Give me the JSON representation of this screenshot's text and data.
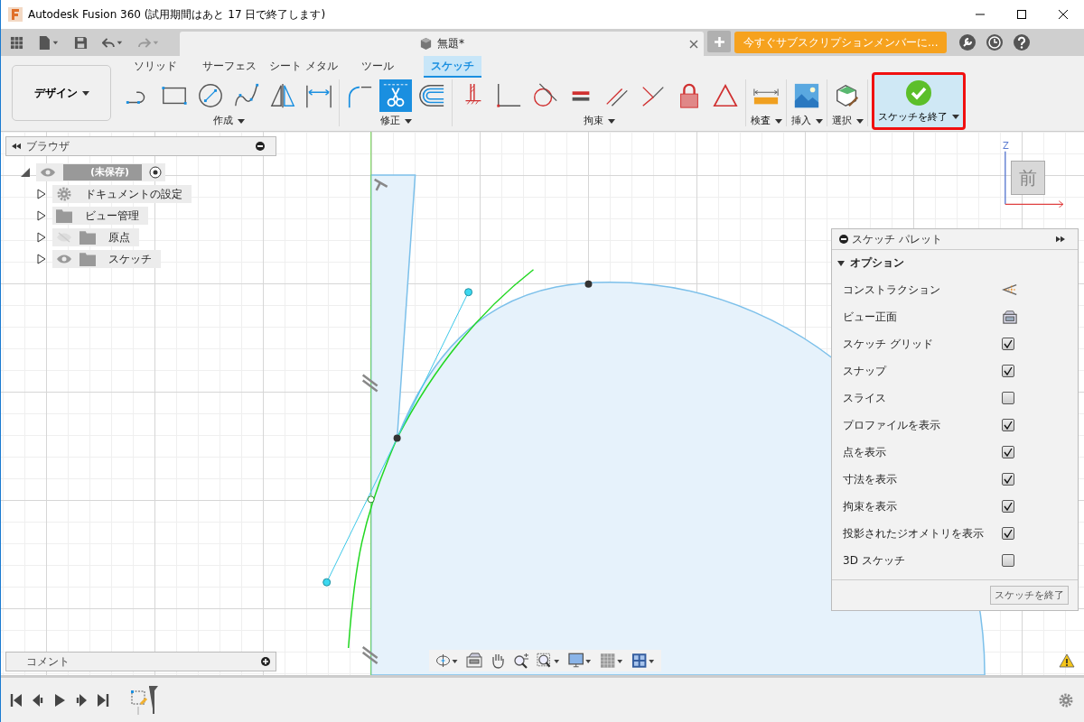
{
  "window": {
    "title": "Autodesk Fusion 360 (試用期間はあと 17 日で終了します)"
  },
  "document_tab": {
    "title": "無題*"
  },
  "subscribe_button": {
    "label": "今すぐサブスクリプションメンバーに..."
  },
  "workspace": {
    "label": "デザイン"
  },
  "ribbon_tabs": [
    {
      "label": "ソリッド",
      "selected": false
    },
    {
      "label": "サーフェス",
      "selected": false
    },
    {
      "label": "シート メタル",
      "selected": false
    },
    {
      "label": "ツール",
      "selected": false
    },
    {
      "label": "スケッチ",
      "selected": true
    }
  ],
  "ribbon_groups": [
    {
      "label": "作成",
      "tools": [
        {
          "kind": "line",
          "selected": false
        },
        {
          "kind": "rectangle",
          "selected": false
        },
        {
          "kind": "circle",
          "selected": false
        },
        {
          "kind": "spline",
          "selected": false
        },
        {
          "kind": "mirror",
          "selected": false
        },
        {
          "kind": "dimension",
          "selected": false
        }
      ]
    },
    {
      "label": "修正",
      "tools": [
        {
          "kind": "fillet",
          "selected": false
        },
        {
          "kind": "trim",
          "selected": true
        },
        {
          "kind": "offset",
          "selected": false
        }
      ]
    },
    {
      "label": "拘束",
      "tools": [
        {
          "kind": "horizontal",
          "selected": false
        },
        {
          "kind": "coincident",
          "selected": false
        },
        {
          "kind": "tangent",
          "selected": false
        },
        {
          "kind": "equal",
          "selected": false
        },
        {
          "kind": "parallel",
          "selected": false
        },
        {
          "kind": "perpendicular",
          "selected": false
        },
        {
          "kind": "fix",
          "selected": false
        },
        {
          "kind": "symmetry",
          "selected": false
        }
      ]
    },
    {
      "label": "検査",
      "tools": [
        {
          "kind": "measure",
          "selected": false
        }
      ]
    },
    {
      "label": "挿入",
      "tools": [
        {
          "kind": "image",
          "selected": false
        }
      ]
    },
    {
      "label": "選択",
      "tools": [
        {
          "kind": "select",
          "selected": false
        }
      ]
    }
  ],
  "finish_sketch": {
    "label": "スケッチを終了",
    "outlined": true
  },
  "browser": {
    "title": "ブラウザ",
    "root": {
      "label": "(未保存)",
      "expanded": true
    },
    "items": [
      {
        "label": "ドキュメントの設定",
        "kind": "settings",
        "expanded": false
      },
      {
        "label": "ビュー管理",
        "kind": "folder",
        "expanded": false
      },
      {
        "label": "原点",
        "kind": "toggle-folder",
        "visible": false,
        "expanded": false
      },
      {
        "label": "スケッチ",
        "kind": "toggle-folder",
        "visible": true,
        "expanded": false
      }
    ]
  },
  "view_cube": {
    "face": "前",
    "axis": "Z"
  },
  "sketch_palette": {
    "title": "スケッチ パレット",
    "section": {
      "label": "オプション",
      "expanded": true
    },
    "options": [
      {
        "label": "コンストラクション",
        "kind": "construction"
      },
      {
        "label": "ビュー正面",
        "kind": "look-at"
      },
      {
        "label": "スケッチ グリッド",
        "kind": "checkbox",
        "checked": true
      },
      {
        "label": "スナップ",
        "kind": "checkbox",
        "checked": true
      },
      {
        "label": "スライス",
        "kind": "checkbox",
        "checked": false
      },
      {
        "label": "プロファイルを表示",
        "kind": "checkbox",
        "checked": true
      },
      {
        "label": "点を表示",
        "kind": "checkbox",
        "checked": true
      },
      {
        "label": "寸法を表示",
        "kind": "checkbox",
        "checked": true
      },
      {
        "label": "拘束を表示",
        "kind": "checkbox",
        "checked": true
      },
      {
        "label": "投影されたジオメトリを表示",
        "kind": "checkbox",
        "checked": true
      },
      {
        "label": "3D スケッチ",
        "kind": "checkbox",
        "checked": false
      }
    ],
    "finish_button": "スケッチを終了"
  },
  "comment_bar": {
    "label": "コメント"
  }
}
